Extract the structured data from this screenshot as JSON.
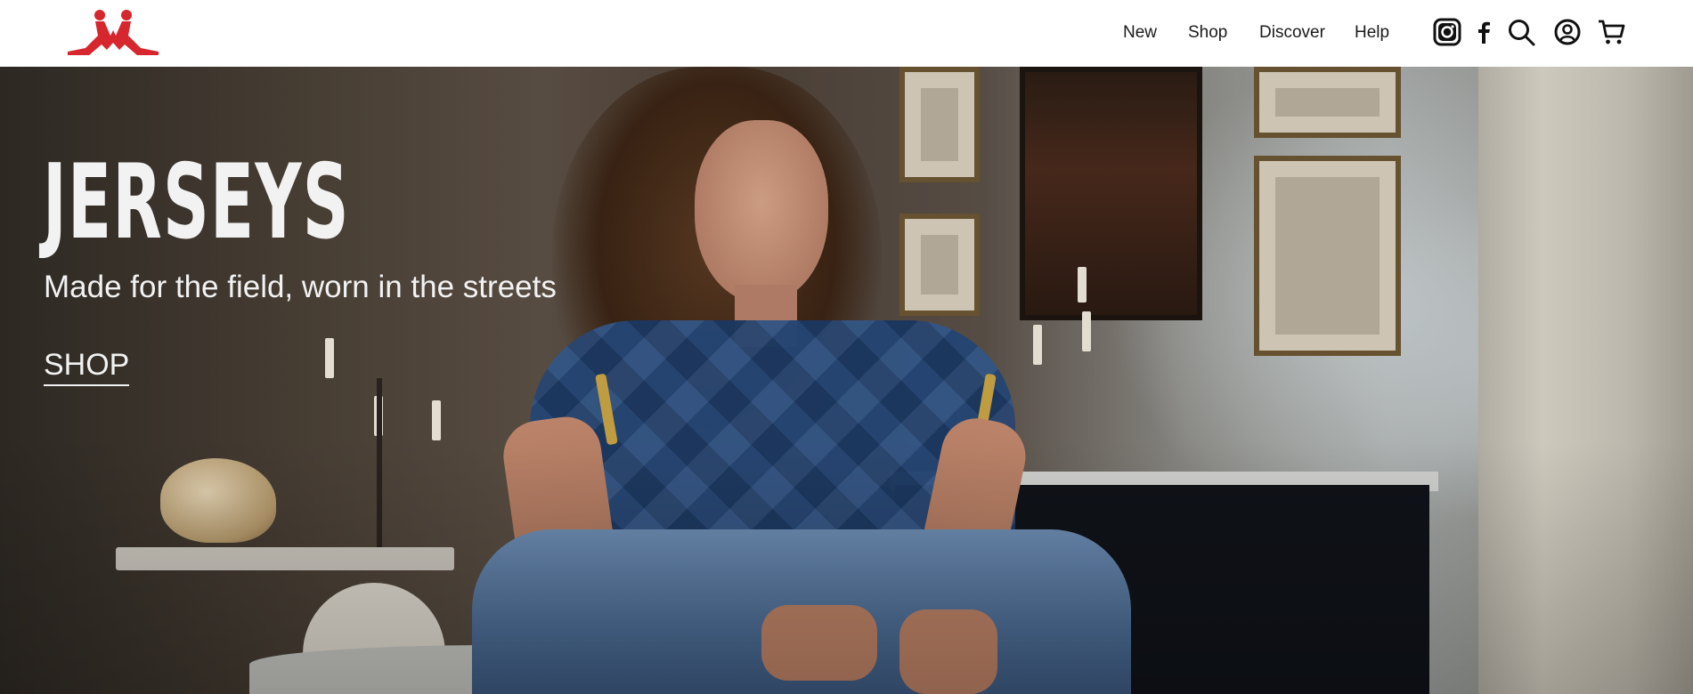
{
  "brand": {
    "logo_icon": "kappa-logo-icon",
    "logo_color": "#d6262e"
  },
  "nav": {
    "items": [
      {
        "label": "New"
      },
      {
        "label": "Shop"
      },
      {
        "label": "Discover"
      },
      {
        "label": "Help"
      }
    ]
  },
  "header_icons": [
    "instagram-icon",
    "facebook-icon",
    "search-icon",
    "account-icon",
    "cart-icon"
  ],
  "hero": {
    "title": "JERSEYS",
    "subtitle": "Made for the field, worn in the streets",
    "cta_label": "SHOP",
    "text_color": "#f2f2f2"
  }
}
